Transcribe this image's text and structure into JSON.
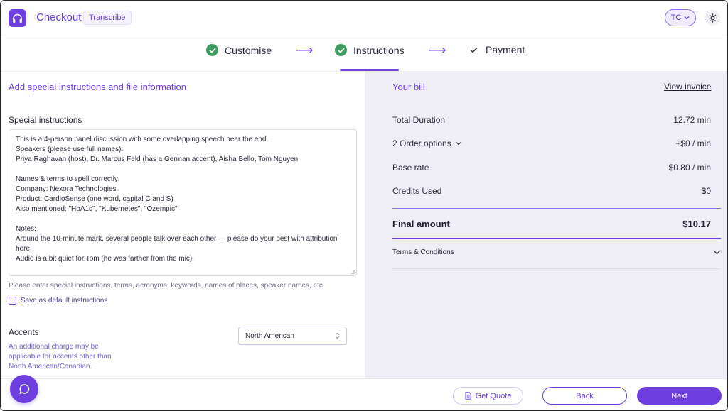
{
  "header": {
    "app_title": "Checkout",
    "badge": "Transcribe",
    "user_initials": "TC",
    "logo_icon": "headphones-icon",
    "theme_icon": "sun-icon"
  },
  "stepper": {
    "steps": [
      {
        "label": "Customise",
        "state": "done"
      },
      {
        "label": "Instructions",
        "state": "done"
      },
      {
        "label": "Payment",
        "state": "current"
      }
    ],
    "arrow": "⟶"
  },
  "instructions_panel": {
    "title": "Add special instructions and file information",
    "special_label": "Special instructions",
    "special_text": "This is a 4-person panel discussion with some overlapping speech near the end.\nSpeakers (please use full names):\nPriya Raghavan (host), Dr. Marcus Feld (has a German accent), Aisha Bello, Tom Nguyen\n\nNames & terms to spell correctly:\nCompany: Nexora Technologies\nProduct: CardioSense (one word, capital C and S)\nAlso mentioned: \"HbA1c\", \"Kubernetes\", \"Ozempic\"\n\nNotes:\nAround the 10-minute mark, several people talk over each other — please do your best with attribution here.\nAudio is a bit quiet for Tom (he was farther from the mic).",
    "help_text": "Please enter special instructions, terms, acronyms, keywords, names of places, speaker names, etc.",
    "save_default_label": "Save as default instructions",
    "save_default_checked": false,
    "accents_label": "Accents",
    "accents_note": "An additional charge may be applicable for accents other than North American/Canadian.",
    "accent_selected": "North American"
  },
  "bill": {
    "title": "Your bill",
    "view_invoice": "View invoice",
    "total_duration_label": "Total Duration",
    "total_duration_value": "12.72 min",
    "order_options_label": "2 Order options",
    "order_options_value": "+$0 / min",
    "base_rate_label": "Base rate",
    "base_rate_value": "$0.80 / min",
    "credits_label": "Credits Used",
    "credits_value": "$0",
    "final_label": "Final amount",
    "final_value": "$10.17",
    "terms_label": "Terms & Conditions"
  },
  "footer": {
    "chat_icon": "chat-bubble-icon",
    "quote_label": "Get Quote",
    "back_label": "Back",
    "next_label": "Next"
  },
  "colors": {
    "accent": "#6e3ee0",
    "success": "#3f9b5f",
    "bill_bg": "#efeef6"
  }
}
